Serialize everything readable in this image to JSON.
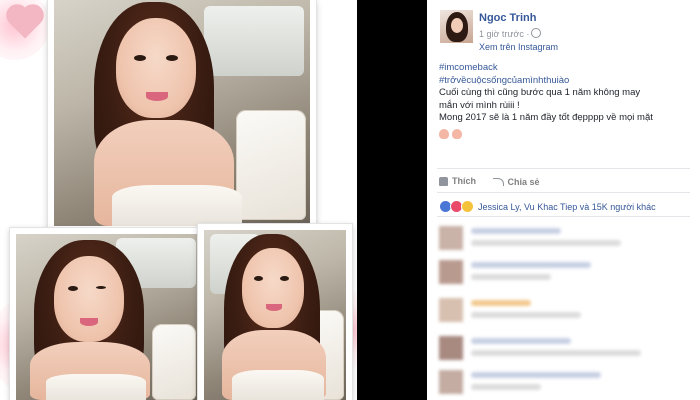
{
  "post": {
    "author": "Ngoc Trinh",
    "time": "1 giờ trước ·",
    "source": "Xem trên Instagram",
    "hashtags": [
      "#imcomeback",
      "#trởvềcuộcsốngcủamìnhthuiào"
    ],
    "lines": [
      "Cuối cùng thì cũng bước qua 1 năm không may",
      "mắn với mình rùiii !",
      "Mong 2017 sẽ là 1 năm đầy tốt đẹpppp về mọi mặt"
    ],
    "like_label": "Thích",
    "share_label": "Chia sẻ",
    "reactions_text": "Jessica Ly, Vu Khac Tiep và 15K người khác"
  },
  "icons": {
    "like": "thumbs-up-icon",
    "share": "share-icon",
    "privacy": "globe-icon",
    "reactions": [
      "like-reaction-icon",
      "love-reaction-icon",
      "haha-reaction-icon"
    ]
  },
  "colors": {
    "link": "#365899",
    "text": "#1d2129",
    "muted": "#90949c",
    "background_right": "#000000"
  }
}
